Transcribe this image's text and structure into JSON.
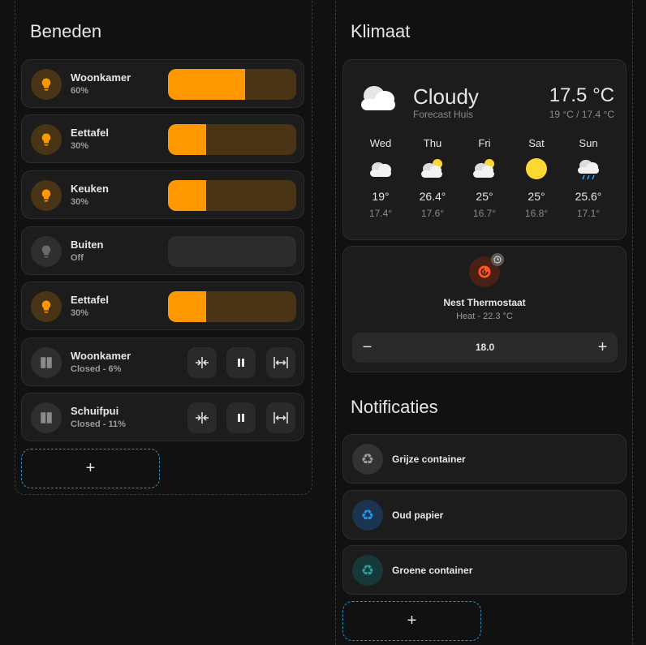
{
  "left_section": {
    "title": "Beneden",
    "lights": [
      {
        "name": "Woonkamer",
        "state": "60%",
        "on": true,
        "level": 0.6
      },
      {
        "name": "Eettafel",
        "state": "30%",
        "on": true,
        "level": 0.3
      },
      {
        "name": "Keuken",
        "state": "30%",
        "on": true,
        "level": 0.3
      },
      {
        "name": "Buiten",
        "state": "Off",
        "on": false,
        "level": 0
      },
      {
        "name": "Eettafel",
        "state": "30%",
        "on": true,
        "level": 0.3
      }
    ],
    "covers": [
      {
        "name": "Woonkamer",
        "state": "Closed - 6%"
      },
      {
        "name": "Schuifpui",
        "state": "Closed - 11%"
      }
    ],
    "cover_buttons": {
      "close": "+|+",
      "stop": "II",
      "open": "|↔|"
    },
    "add_label": "+"
  },
  "right_section": {
    "title": "Klimaat",
    "weather": {
      "condition": "Cloudy",
      "source": "Forecast Huis",
      "temperature": "17.5 °C",
      "range": "19 °C / 17.4 °C",
      "forecast": [
        {
          "day": "Wed",
          "icon": "cloudy-icon",
          "high": "19°",
          "low": "17.4°"
        },
        {
          "day": "Thu",
          "icon": "partly-cloudy-icon",
          "high": "26.4°",
          "low": "17.6°"
        },
        {
          "day": "Fri",
          "icon": "partly-cloudy-icon",
          "high": "25°",
          "low": "16.7°"
        },
        {
          "day": "Sat",
          "icon": "sunny-icon",
          "high": "25°",
          "low": "16.8°"
        },
        {
          "day": "Sun",
          "icon": "rainy-icon",
          "high": "25.6°",
          "low": "17.1°"
        }
      ]
    },
    "thermostat": {
      "name": "Nest Thermostaat",
      "state": "Heat - 22.3 °C",
      "target": "18.0",
      "minus": "−",
      "plus": "+"
    },
    "notifications_title": "Notificaties",
    "notifications": [
      {
        "label": "Grijze container",
        "color": "#9e9e9e"
      },
      {
        "label": "Oud papier",
        "color": "#2196f3"
      },
      {
        "label": "Groene container",
        "color": "#26a69a"
      }
    ],
    "add_label": "+"
  },
  "colors": {
    "accent": "#ff9800",
    "accent_dim": "#4a3416",
    "heat": "#ff5722",
    "dashed_border": "#2d8fc7"
  }
}
